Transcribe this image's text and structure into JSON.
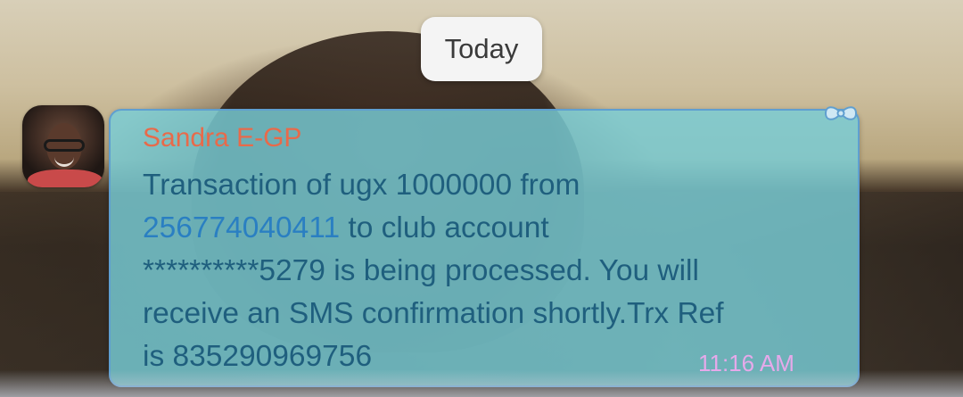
{
  "chat": {
    "date_separator": "Today",
    "message": {
      "sender": "Sandra E-GP",
      "line1": "Transaction of ugx 1000000 from",
      "phone": "256774040411",
      "line2_rest": " to club account",
      "line3": "**********5279 is being processed. You will",
      "line4": "receive an SMS confirmation shortly.Trx Ref",
      "line5": "is 835290969756",
      "time": "11:16 AM"
    }
  },
  "colors": {
    "bubble_fill": "#78cdd7",
    "bubble_border": "#5f9fd0",
    "sender_color": "#e86a4a",
    "text_color": "#1f5f7e",
    "link_color": "#2a7fc2",
    "time_color": "#e6a9ea"
  },
  "icons": {
    "bubble_corner": "bow-icon",
    "avatar": "contact-avatar"
  }
}
